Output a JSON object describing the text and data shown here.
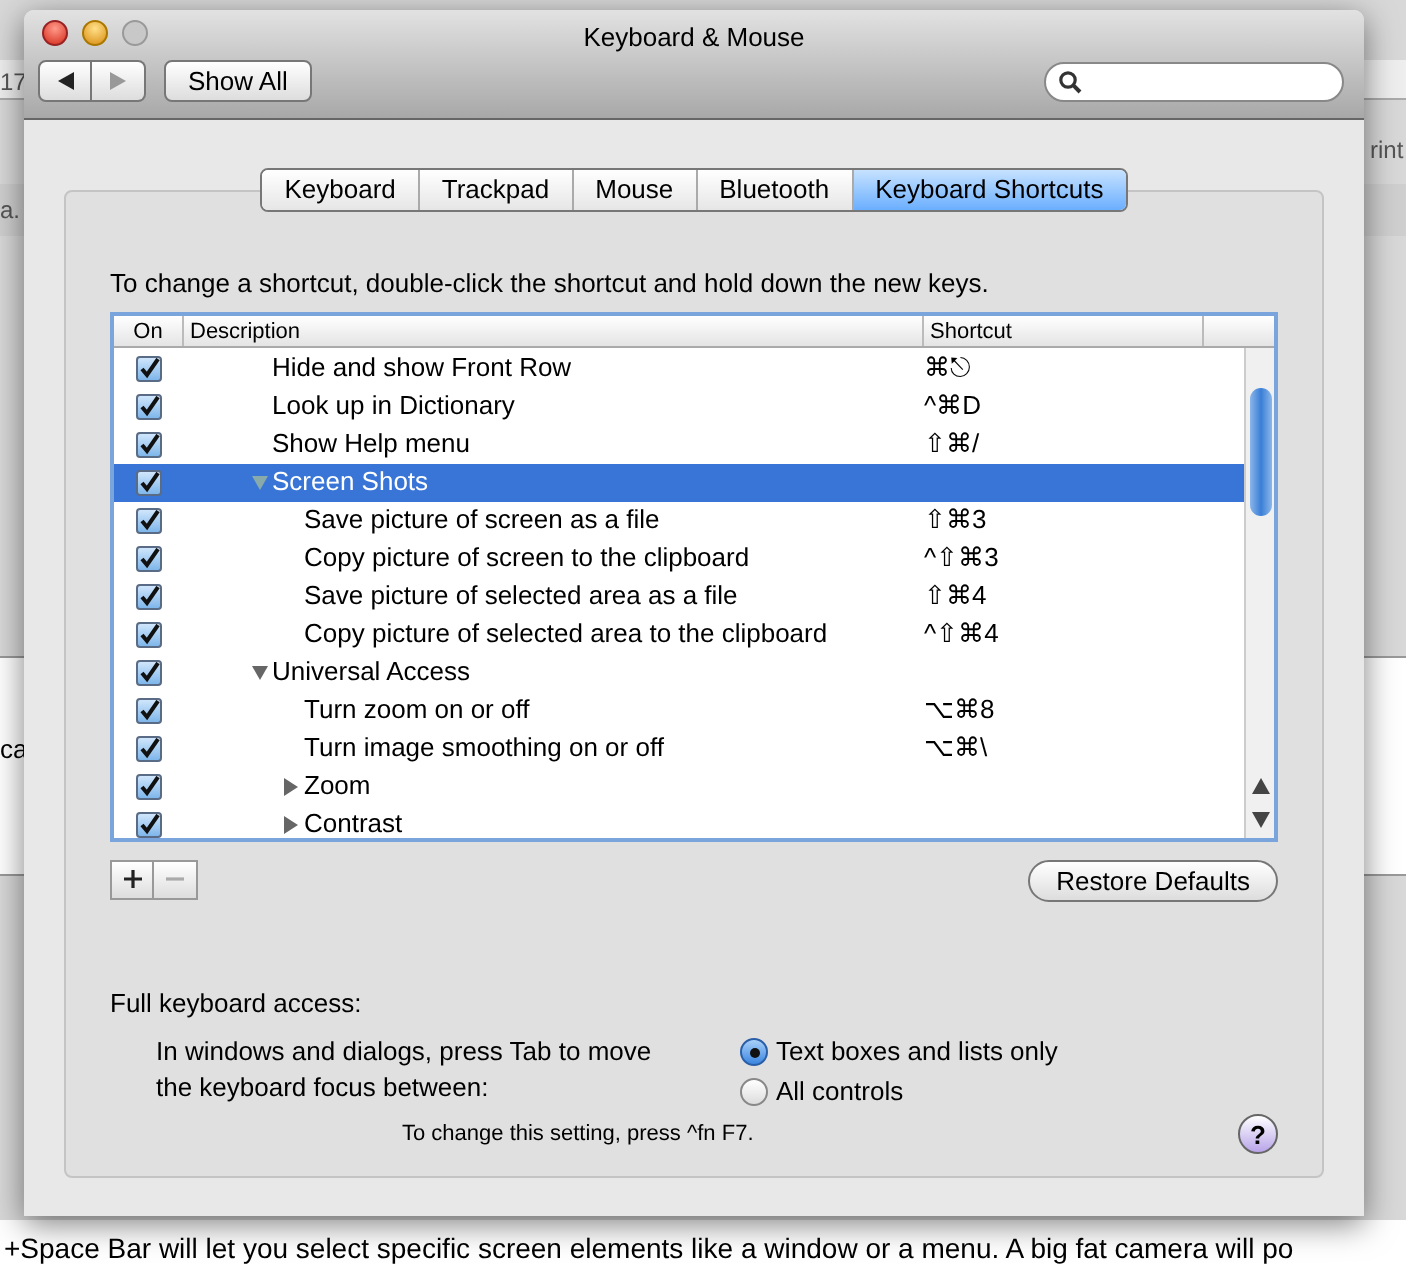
{
  "background": {
    "fragments": [
      "17",
      "a.",
      "ca"
    ],
    "right_fragment": "rint",
    "bottom_text": "+Space Bar will let you select specific screen elements like a window or a menu. A big fat camera will po"
  },
  "window": {
    "title": "Keyboard & Mouse",
    "show_all": "Show All"
  },
  "tabs": [
    {
      "label": "Keyboard",
      "selected": false
    },
    {
      "label": "Trackpad",
      "selected": false
    },
    {
      "label": "Mouse",
      "selected": false
    },
    {
      "label": "Bluetooth",
      "selected": false
    },
    {
      "label": "Keyboard Shortcuts",
      "selected": true
    }
  ],
  "instruction": "To change a shortcut, double-click the shortcut and hold down the new keys.",
  "table": {
    "columns": [
      "On",
      "Description",
      "Shortcut"
    ],
    "rows": [
      {
        "on": true,
        "description": "Hide and show Front Row",
        "shortcut": "⌘⎋",
        "selected": false
      },
      {
        "on": true,
        "description": "Look up in Dictionary",
        "shortcut": "^⌘D",
        "selected": false
      },
      {
        "on": true,
        "description": "Show Help menu",
        "shortcut": "⇧⌘/",
        "selected": false
      },
      {
        "on": true,
        "description": "Screen Shots",
        "selected": true,
        "expanded": true,
        "children": [
          {
            "on": true,
            "description": "Save picture of screen as a file",
            "shortcut": "⇧⌘3",
            "selected": false
          },
          {
            "on": true,
            "description": "Copy picture of screen to the clipboard",
            "shortcut": "^⇧⌘3",
            "selected": false
          },
          {
            "on": true,
            "description": "Save picture of selected area as a file",
            "shortcut": "⇧⌘4",
            "selected": false
          },
          {
            "on": true,
            "description": "Copy picture of selected area to the clipboard",
            "shortcut": "^⇧⌘4",
            "selected": false
          }
        ]
      },
      {
        "on": true,
        "description": "Universal Access",
        "selected": false,
        "expanded": true,
        "children": [
          {
            "on": true,
            "description": "Turn zoom on or off",
            "shortcut": "⌥⌘8",
            "selected": false
          },
          {
            "on": true,
            "description": "Turn image smoothing on or off",
            "shortcut": "⌥⌘\\",
            "selected": false
          },
          {
            "on": true,
            "description": "Zoom",
            "selected": false,
            "expanded": false
          },
          {
            "on": true,
            "description": "Contrast",
            "selected": false,
            "expanded": false
          }
        ]
      }
    ]
  },
  "restore_button": "Restore Defaults",
  "keyboard_access": {
    "heading": "Full keyboard access:",
    "description_lines": [
      "In windows and dialogs, press Tab to move",
      "the keyboard focus between:"
    ],
    "options": [
      {
        "label": "Text boxes and lists only",
        "selected": true
      },
      {
        "label": "All controls",
        "selected": false
      }
    ],
    "hint": "To change this setting, press ^fn F7."
  },
  "help_button": "?"
}
